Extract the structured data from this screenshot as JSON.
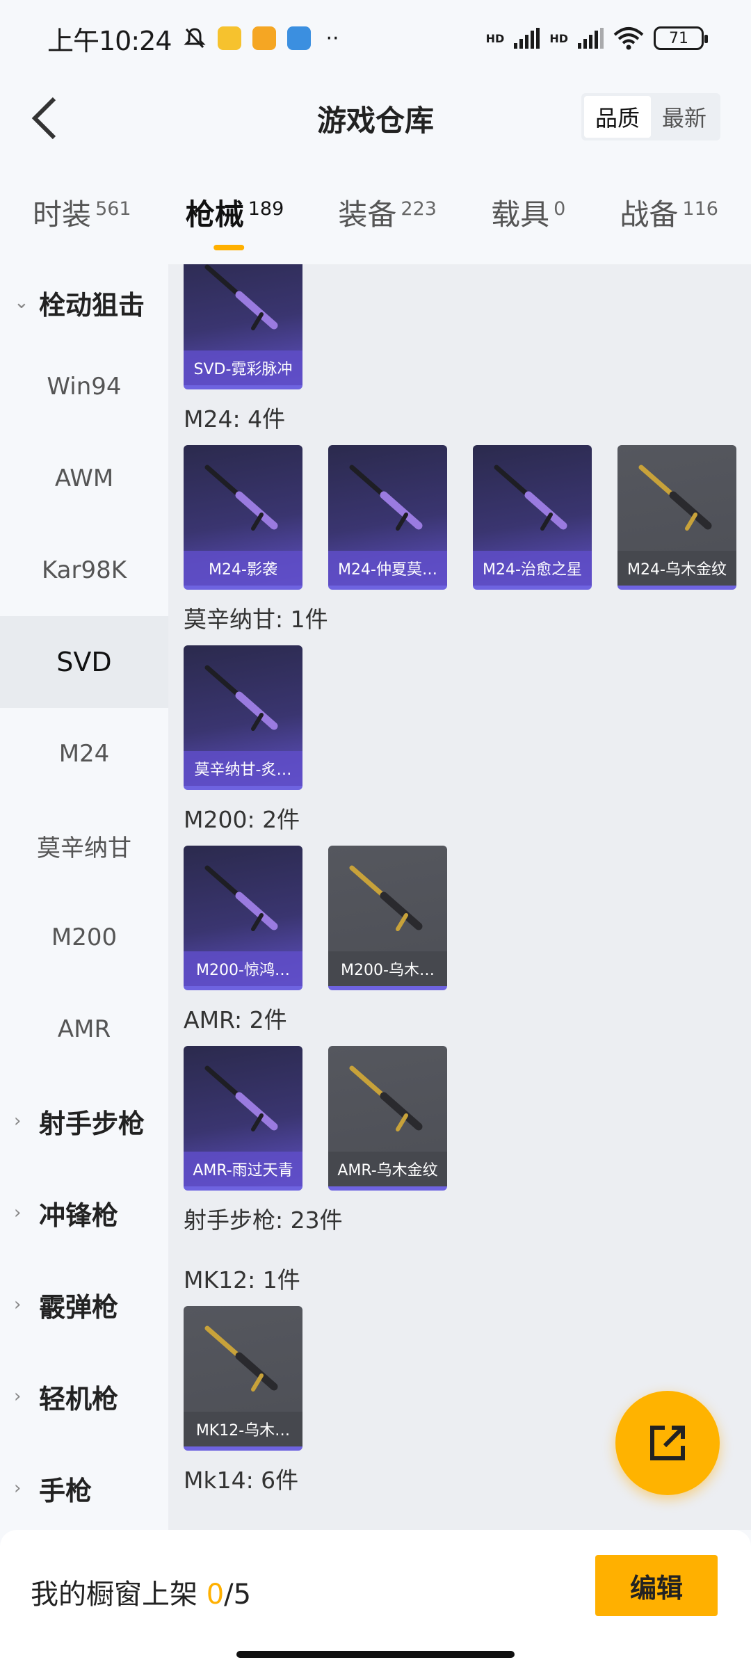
{
  "status_bar": {
    "time": "上午10:24",
    "battery": "71",
    "hd1": "HD",
    "hd2": "HD"
  },
  "header": {
    "title": "游戏仓库",
    "sort_options": [
      "品质",
      "最新"
    ],
    "active_sort": "品质"
  },
  "tabs": [
    {
      "label": "时装",
      "count": "561"
    },
    {
      "label": "枪械",
      "count": "189"
    },
    {
      "label": "装备",
      "count": "223"
    },
    {
      "label": "载具",
      "count": "0"
    },
    {
      "label": "战备",
      "count": "116"
    }
  ],
  "active_tab": "枪械",
  "sidebar": {
    "group_open": "栓动狙击",
    "items": [
      "Win94",
      "AWM",
      "Kar98K",
      "SVD",
      "M24",
      "莫辛纳甘",
      "M200",
      "AMR"
    ],
    "active_item": "SVD",
    "groups_closed": [
      "射手步枪",
      "冲锋枪",
      "霰弹枪",
      "轻机枪",
      "手枪"
    ]
  },
  "content": {
    "svd_items": [
      {
        "label": "SVD-霓彩脉冲",
        "style": "purple"
      }
    ],
    "sections": [
      {
        "title": "M24: 4件",
        "items": [
          {
            "label": "M24-影袭",
            "style": "purple"
          },
          {
            "label": "M24-仲夏莫…",
            "style": "purple"
          },
          {
            "label": "M24-治愈之星",
            "style": "purple"
          },
          {
            "label": "M24-乌木金纹",
            "style": "gray"
          }
        ]
      },
      {
        "title": "莫辛纳甘: 1件",
        "items": [
          {
            "label": "莫辛纳甘-炙…",
            "style": "purple"
          }
        ]
      },
      {
        "title": "M200: 2件",
        "items": [
          {
            "label": "M200-惊鸿…",
            "style": "purple"
          },
          {
            "label": "M200-乌木…",
            "style": "gray"
          }
        ]
      },
      {
        "title": "AMR: 2件",
        "items": [
          {
            "label": "AMR-雨过天青",
            "style": "purple"
          },
          {
            "label": "AMR-乌木金纹",
            "style": "gray"
          }
        ]
      }
    ],
    "marksman_title": "射手步枪: 23件",
    "mk12_title": "MK12: 1件",
    "mk12_items": [
      {
        "label": "MK12-乌木…",
        "style": "gray"
      }
    ],
    "mk14_title": "Mk14: 6件"
  },
  "bottom_bar": {
    "showcase_label": "我的橱窗上架",
    "showcase_current": "0",
    "showcase_total": "/5",
    "edit_label": "编辑"
  },
  "colors": {
    "accent": "#ffb000",
    "purple_card": "#6152c8",
    "gray_card": "#4d4f56"
  }
}
